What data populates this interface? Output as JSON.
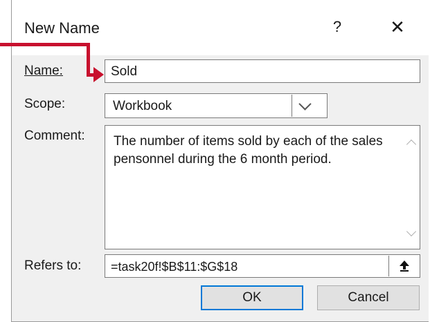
{
  "dialog": {
    "title": "New Name",
    "help_glyph": "?",
    "close_glyph": "✕"
  },
  "fields": {
    "name_label": "Name:",
    "name_value": "Sold",
    "scope_label": "Scope:",
    "scope_value": "Workbook",
    "comment_label": "Comment:",
    "comment_value": "The number of items sold by each of the sales pensonnel during the 6 month period.",
    "refers_label": "Refers to:",
    "refers_value": "=task20f!$B$11:$G$18"
  },
  "buttons": {
    "ok": "OK",
    "cancel": "Cancel"
  },
  "icons": {
    "help": "question-mark-icon",
    "close": "close-icon",
    "dropdown": "chevron-down-icon",
    "collapse": "collapse-dialog-icon",
    "callout": "red-callout-arrow"
  },
  "colors": {
    "callout": "#c8102e",
    "focus_border": "#0078d7"
  }
}
